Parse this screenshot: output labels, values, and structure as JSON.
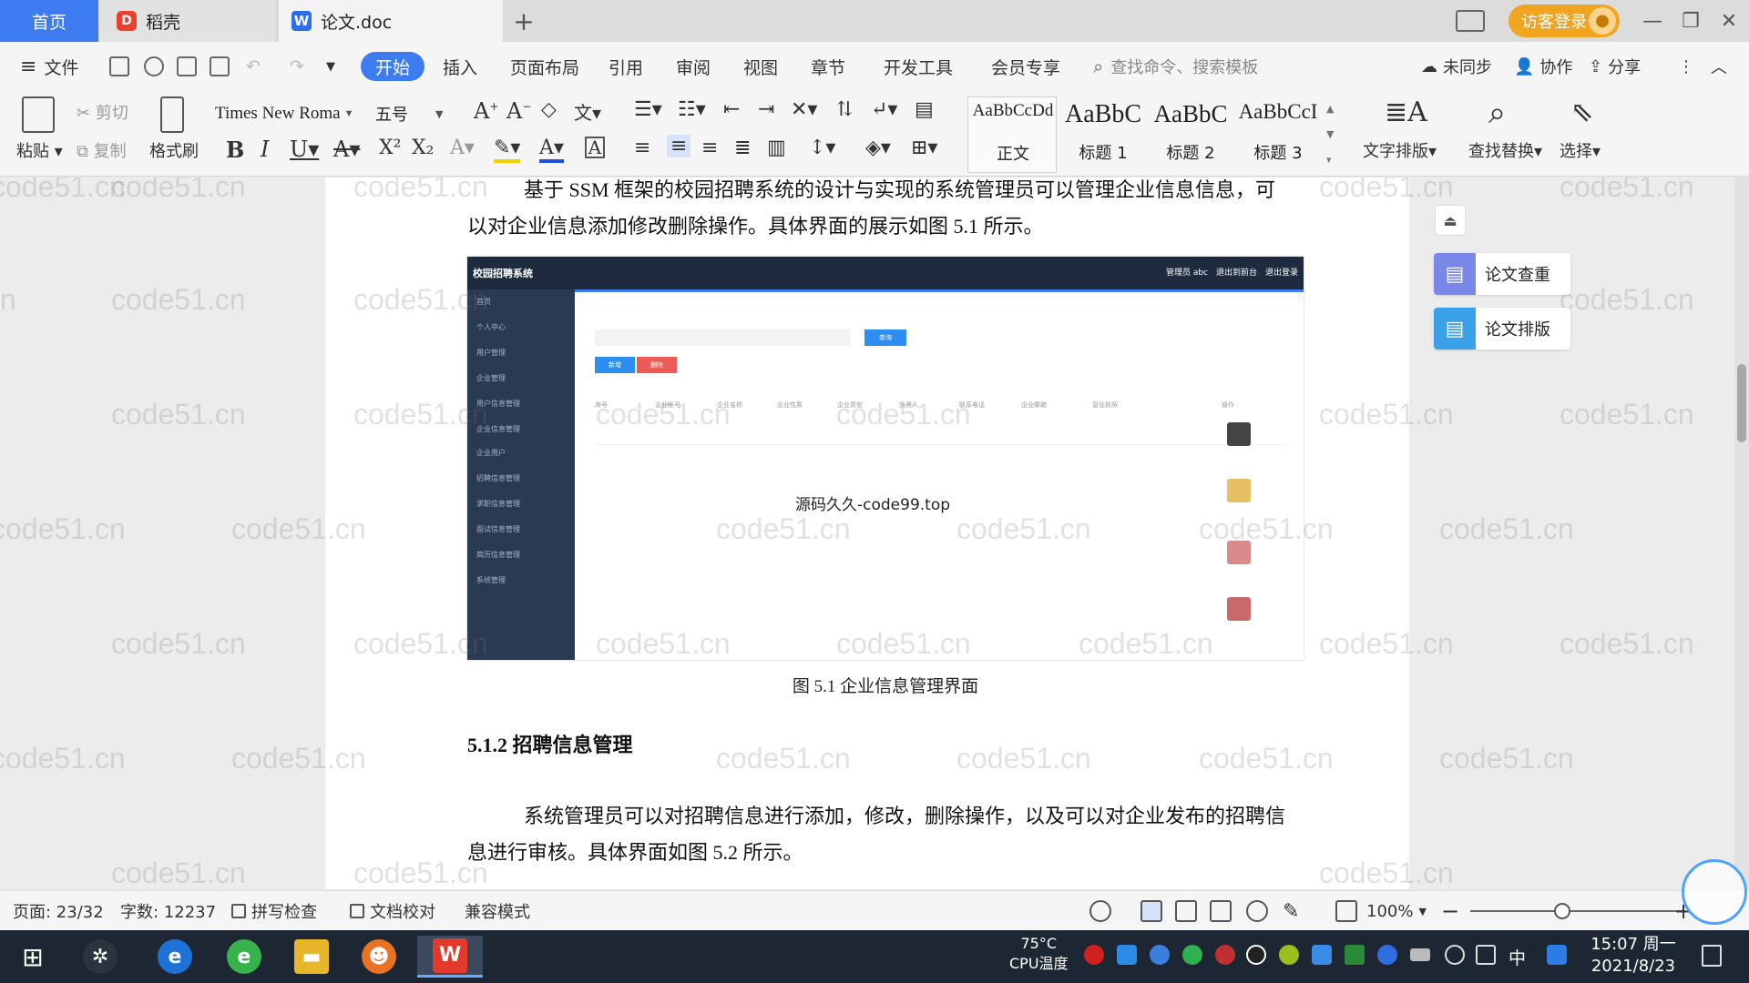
{
  "tabs": {
    "home": "首页",
    "daoke": "稻壳",
    "doc": "论文.doc",
    "add": "+"
  },
  "header": {
    "login": "访客登录",
    "minimize": "—",
    "restore": "❐",
    "close": "✕"
  },
  "menu": {
    "file": "文件",
    "items": [
      "开始",
      "插入",
      "页面布局",
      "引用",
      "审阅",
      "视图",
      "章节",
      "开发工具",
      "会员专享"
    ],
    "search_placeholder": "查找命令、搜索模板",
    "sync": "未同步",
    "collab": "协作",
    "share": "分享"
  },
  "ribbon": {
    "paste": "粘贴",
    "cut": "剪切",
    "copy": "复制",
    "format_painter": "格式刷",
    "font_name": "Times New Roma",
    "font_size": "五号",
    "styles": [
      {
        "sample": "AaBbCcDd",
        "name": "正文"
      },
      {
        "sample": "AaBbC",
        "name": "标题 1"
      },
      {
        "sample": "AaBbC",
        "name": "标题 2"
      },
      {
        "sample": "AaBbCcI",
        "name": "标题 3"
      }
    ],
    "text_layout": "文字排版",
    "find_replace": "查找替换",
    "select": "选择"
  },
  "document": {
    "para1": "基于 SSM 框架的校园招聘系统的设计与实现的系统管理员可以管理企业信息信息，可以对企业信息添加修改删除操作。具体界面的展示如图 5.1 所示。",
    "figure_title": "校园招聘系统",
    "figure_header_right": "管理员 abc　退出到前台　退出登录",
    "figure_side_items": [
      "首页",
      "个人中心",
      "用户管理",
      "企业管理",
      "用户信息管理",
      "企业信息管理",
      "企业用户",
      "招聘信息管理",
      "求职信息管理",
      "面试信息管理",
      "简历信息管理",
      "系统管理"
    ],
    "figure_buttons": {
      "search": "查询",
      "add": "新增",
      "delete": "删除"
    },
    "figure_columns": [
      "序号",
      "企业账号",
      "企业名称",
      "企业性质",
      "企业类型",
      "负责人",
      "联系电话",
      "企业邮箱",
      "营业执照",
      "操作"
    ],
    "figure_watermark": "源码久久-code99.top",
    "caption": "图 5.1  企业信息管理界面",
    "heading": "5.1.2  招聘信息管理",
    "para2": "系统管理员可以对招聘信息进行添加，修改，删除操作，以及可以对企业发布的招聘信息进行审核。具体界面如图 5.2 所示。",
    "watermark": "code51.cn"
  },
  "side_panel": {
    "check": "论文查重",
    "layout": "论文排版"
  },
  "status": {
    "page": "页面: 23/32",
    "words": "字数: 12237",
    "spell": "拼写检查",
    "proof": "文档校对",
    "compat": "兼容模式",
    "zoom": "100%",
    "zoom_value_percent": 100
  },
  "taskbar": {
    "cpu_temp": "75°C",
    "cpu_label": "CPU温度",
    "ime": "中",
    "time": "15:07 周一",
    "date": "2021/8/23"
  },
  "colors": {
    "accent": "#3d7cf0",
    "login": "#f0a420",
    "taskbar": "#1d2733"
  }
}
